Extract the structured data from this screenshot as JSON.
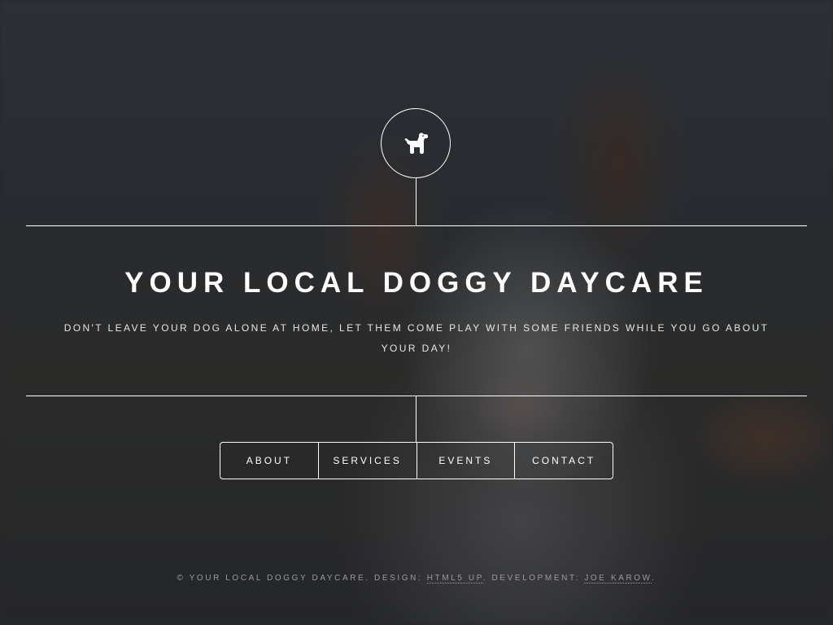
{
  "logo": {
    "icon": "dog-icon"
  },
  "header": {
    "title": "YOUR LOCAL DOGGY DAYCARE",
    "subtitle": "DON'T LEAVE YOUR DOG ALONE AT HOME, LET THEM COME PLAY WITH SOME FRIENDS WHILE YOU GO ABOUT YOUR DAY!"
  },
  "nav": {
    "items": [
      {
        "label": "ABOUT"
      },
      {
        "label": "SERVICES"
      },
      {
        "label": "EVENTS"
      },
      {
        "label": "CONTACT"
      }
    ]
  },
  "footer": {
    "copyright": "© YOUR LOCAL DOGGY DAYCARE. DESIGN: ",
    "design_link": "HTML5 UP",
    "development_text": ". DEVELOPMENT: ",
    "development_link": "JOE KAROW",
    "end": "."
  },
  "colors": {
    "text": "#ffffff",
    "footer_text": "#9a9b9e",
    "background": "#2a2c30"
  }
}
